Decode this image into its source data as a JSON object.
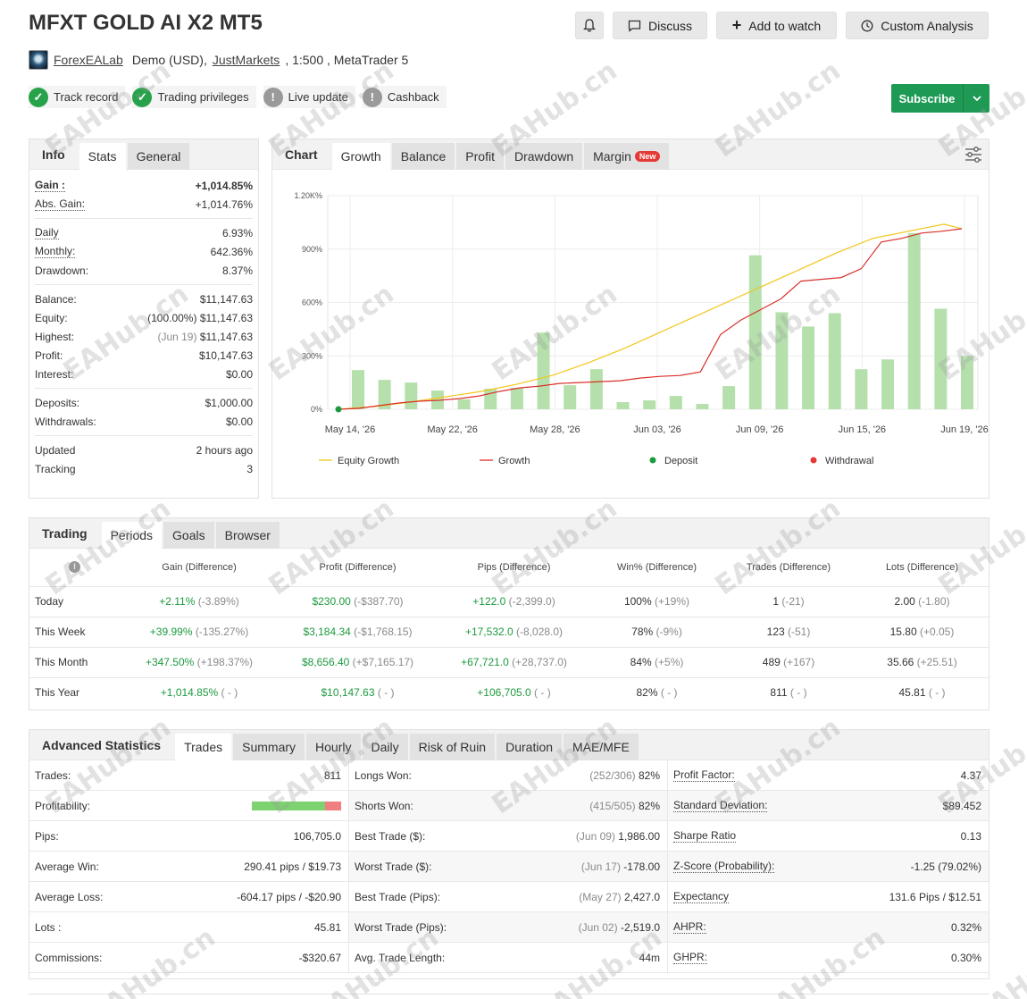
{
  "header": {
    "title": "MFXT GOLD AI X2 MT5",
    "discuss_label": "Discuss",
    "watch_label": "Add to watch",
    "custom_label": "Custom Analysis",
    "owner": "ForexEALab",
    "account_type": "Demo (USD),",
    "broker": "JustMarkets",
    "leverage": ", 1:500 , MetaTrader 5",
    "subscribe_label": "Subscribe"
  },
  "badges": [
    {
      "label": "Track record",
      "status": "ok"
    },
    {
      "label": "Trading privileges",
      "status": "ok"
    },
    {
      "label": "Live update",
      "status": "warn"
    },
    {
      "label": "Cashback",
      "status": "warn"
    }
  ],
  "info_tabs": [
    "Info",
    "Stats",
    "General"
  ],
  "info": {
    "gain_k": "Gain :",
    "gain_v": "+1,014.85%",
    "absgain_k": "Abs. Gain:",
    "absgain_v": "+1,014.76%",
    "daily_k": "Daily",
    "daily_v": "6.93%",
    "monthly_k": "Monthly:",
    "monthly_v": "642.36%",
    "drawdown_k": "Drawdown:",
    "drawdown_v": "8.37%",
    "balance_k": "Balance:",
    "balance_v": "$11,147.63",
    "equity_k": "Equity:",
    "equity_pct": "(100.00%)",
    "equity_v": "$11,147.63",
    "highest_k": "Highest:",
    "highest_date": "(Jun 19)",
    "highest_v": "$11,147.63",
    "profit_k": "Profit:",
    "profit_v": "$10,147.63",
    "interest_k": "Interest:",
    "interest_v": "$0.00",
    "deposits_k": "Deposits:",
    "deposits_v": "$1,000.00",
    "withdrawals_k": "Withdrawals:",
    "withdrawals_v": "$0.00",
    "updated_k": "Updated",
    "updated_v": "2 hours ago",
    "tracking_k": "Tracking",
    "tracking_v": "3"
  },
  "chart_tabs": [
    "Chart",
    "Growth",
    "Balance",
    "Profit",
    "Drawdown",
    "Margin"
  ],
  "chart_new_badge": "New",
  "chart_data": {
    "type": "bar",
    "ytick_labels": [
      "0%",
      "300%",
      "600%",
      "900%",
      "1.20K%"
    ],
    "yticks": [
      0,
      300,
      600,
      900,
      1200
    ],
    "ylim": [
      0,
      1200
    ],
    "xtick_labels": [
      "May 14, '26",
      "May 22, '26",
      "May 28, '26",
      "Jun 03, '26",
      "Jun 09, '26",
      "Jun 15, '26",
      "Jun 19, '26"
    ],
    "bars": [
      220,
      165,
      150,
      105,
      55,
      115,
      120,
      430,
      135,
      225,
      40,
      50,
      75,
      30,
      130,
      865,
      545,
      465,
      540,
      225,
      280,
      990,
      565,
      300
    ],
    "series": [
      {
        "name": "Equity Growth",
        "color": "#f2c618",
        "points": [
          [
            0,
            0
          ],
          [
            2,
            15
          ],
          [
            4,
            40
          ],
          [
            6,
            70
          ],
          [
            8,
            100
          ],
          [
            10,
            140
          ],
          [
            12,
            190
          ],
          [
            14,
            260
          ],
          [
            16,
            340
          ],
          [
            18,
            430
          ],
          [
            20,
            520
          ],
          [
            22,
            610
          ],
          [
            24,
            700
          ],
          [
            26,
            790
          ],
          [
            28,
            880
          ],
          [
            30,
            960
          ],
          [
            32,
            1000
          ],
          [
            34,
            1040
          ],
          [
            35,
            1014
          ]
        ]
      },
      {
        "name": "Growth",
        "color": "#d9312b",
        "points": [
          [
            0,
            0
          ],
          [
            1,
            5
          ],
          [
            2,
            20
          ],
          [
            3,
            35
          ],
          [
            4,
            45
          ],
          [
            5,
            50
          ],
          [
            6,
            60
          ],
          [
            7,
            75
          ],
          [
            8,
            100
          ],
          [
            9,
            120
          ],
          [
            10,
            130
          ],
          [
            11,
            145
          ],
          [
            12,
            150
          ],
          [
            13,
            155
          ],
          [
            14,
            160
          ],
          [
            15,
            175
          ],
          [
            16,
            185
          ],
          [
            17,
            190
          ],
          [
            18,
            210
          ],
          [
            19,
            420
          ],
          [
            20,
            500
          ],
          [
            21,
            560
          ],
          [
            22,
            620
          ],
          [
            23,
            720
          ],
          [
            24,
            730
          ],
          [
            25,
            740
          ],
          [
            26,
            790
          ],
          [
            27,
            940
          ],
          [
            28,
            960
          ],
          [
            29,
            990
          ],
          [
            30,
            1000
          ],
          [
            31,
            1014
          ]
        ]
      }
    ],
    "legend": [
      "Equity Growth",
      "Growth",
      "Deposit",
      "Withdrawal"
    ],
    "legend_colors": [
      "#f2c618",
      "#d9312b",
      "#1c9a3e",
      "#e53935"
    ]
  },
  "trading_tabs": [
    "Trading",
    "Periods",
    "Goals",
    "Browser"
  ],
  "trading_headers": [
    "Gain (Difference)",
    "Profit (Difference)",
    "Pips (Difference)",
    "Win% (Difference)",
    "Trades (Difference)",
    "Lots (Difference)"
  ],
  "trading_rows": [
    {
      "label": "Today",
      "gain": "+2.11%",
      "gain_d": "(-3.89%)",
      "profit": "$230.00",
      "profit_d": "(-$387.70)",
      "pips": "+122.0",
      "pips_d": "(-2,399.0)",
      "win": "100%",
      "win_d": "(+19%)",
      "trades": "1",
      "trades_d": "(-21)",
      "lots": "2.00",
      "lots_d": "(-1.80)"
    },
    {
      "label": "This Week",
      "gain": "+39.99%",
      "gain_d": "(-135.27%)",
      "profit": "$3,184.34",
      "profit_d": "(-$1,768.15)",
      "pips": "+17,532.0",
      "pips_d": "(-8,028.0)",
      "win": "78%",
      "win_d": "(-9%)",
      "trades": "123",
      "trades_d": "(-51)",
      "lots": "15.80",
      "lots_d": "(+0.05)"
    },
    {
      "label": "This Month",
      "gain": "+347.50%",
      "gain_d": "(+198.37%)",
      "profit": "$8,656.40",
      "profit_d": "(+$7,165.17)",
      "pips": "+67,721.0",
      "pips_d": "(+28,737.0)",
      "win": "84%",
      "win_d": "(+5%)",
      "trades": "489",
      "trades_d": "(+167)",
      "lots": "35.66",
      "lots_d": "(+25.51)"
    },
    {
      "label": "This Year",
      "gain": "+1,014.85%",
      "gain_d": "( - )",
      "profit": "$10,147.63",
      "profit_d": "( - )",
      "pips": "+106,705.0",
      "pips_d": "( - )",
      "win": "82%",
      "win_d": "( - )",
      "trades": "811",
      "trades_d": "( - )",
      "lots": "45.81",
      "lots_d": "( - )"
    }
  ],
  "adv_tabs": [
    "Advanced Statistics",
    "Trades",
    "Summary",
    "Hourly",
    "Daily",
    "Risk of Ruin",
    "Duration",
    "MAE/MFE"
  ],
  "adv": {
    "col1": [
      {
        "k": "Trades:",
        "v": "811"
      },
      {
        "k": "Profitability:",
        "v": ""
      },
      {
        "k": "Pips:",
        "v": "106,705.0"
      },
      {
        "k": "Average Win:",
        "v": "290.41 pips / $19.73"
      },
      {
        "k": "Average Loss:",
        "v": "-604.17 pips / -$20.90"
      },
      {
        "k": "Lots :",
        "v": "45.81"
      },
      {
        "k": "Commissions:",
        "v": "-$320.67"
      }
    ],
    "col2": [
      {
        "k": "Longs Won:",
        "d": "(252/306)",
        "v": "82%"
      },
      {
        "k": "Shorts Won:",
        "d": "(415/505)",
        "v": "82%"
      },
      {
        "k": "Best Trade ($):",
        "d": "(Jun 09)",
        "v": "1,986.00"
      },
      {
        "k": "Worst Trade ($):",
        "d": "(Jun 17)",
        "v": "-178.00"
      },
      {
        "k": "Best Trade (Pips):",
        "d": "(May 27)",
        "v": "2,427.0"
      },
      {
        "k": "Worst Trade (Pips):",
        "d": "(Jun 02)",
        "v": "-2,519.0"
      },
      {
        "k": "Avg. Trade Length:",
        "d": "",
        "v": "44m"
      }
    ],
    "col3": [
      {
        "k": "Profit Factor:",
        "v": "4.37"
      },
      {
        "k": "Standard Deviation:",
        "v": "$89.452"
      },
      {
        "k": "Sharpe Ratio",
        "v": "0.13"
      },
      {
        "k": "Z-Score (Probability):",
        "v": "-1.25 (79.02%)"
      },
      {
        "k": "Expectancy",
        "v": "131.6 Pips / $12.51"
      },
      {
        "k": "AHPR:",
        "v": "0.32%"
      },
      {
        "k": "GHPR:",
        "v": "0.30%"
      }
    ],
    "profitability_win_pct": 82
  },
  "watermark": "EAHub.cn"
}
